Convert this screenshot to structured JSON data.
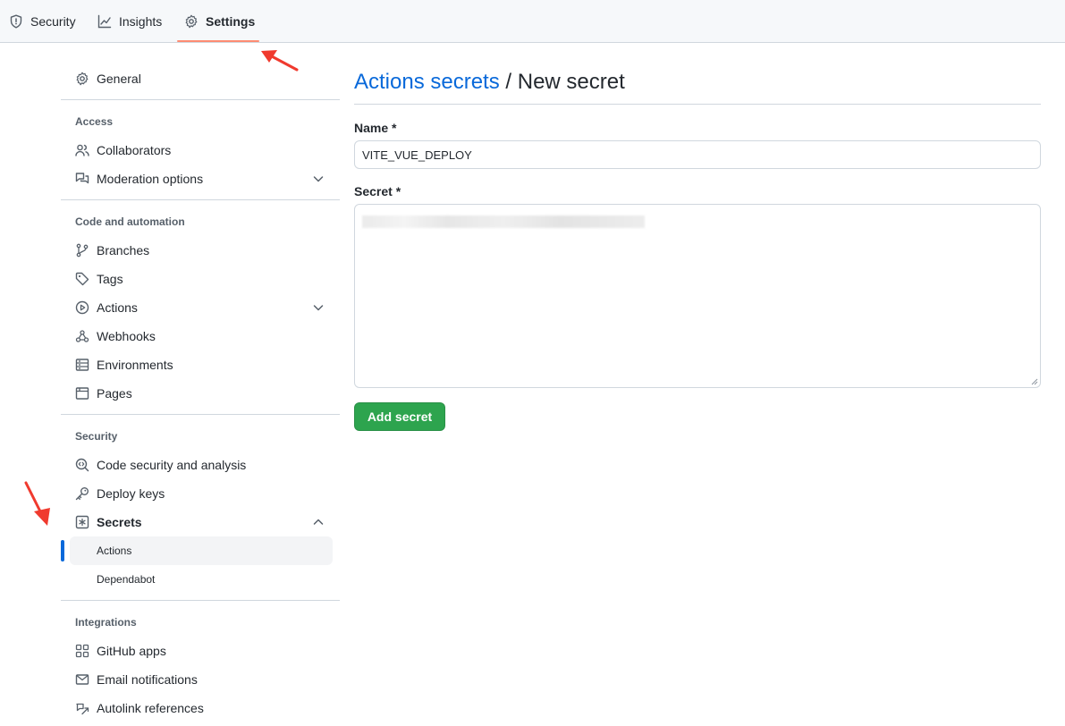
{
  "tabs": [
    {
      "label": "Security",
      "icon": "shield-icon"
    },
    {
      "label": "Insights",
      "icon": "graph-icon"
    },
    {
      "label": "Settings",
      "icon": "gear-icon",
      "selected": true
    }
  ],
  "sidebar": {
    "general": "General",
    "sections": [
      {
        "heading": "Access",
        "items": [
          "Collaborators",
          "Moderation options"
        ]
      },
      {
        "heading": "Code and automation",
        "items": [
          "Branches",
          "Tags",
          "Actions",
          "Webhooks",
          "Environments",
          "Pages"
        ]
      },
      {
        "heading": "Security",
        "items": [
          "Code security and analysis",
          "Deploy keys",
          "Secrets"
        ],
        "sub_items": [
          "Actions",
          "Dependabot"
        ]
      },
      {
        "heading": "Integrations",
        "items": [
          "GitHub apps",
          "Email notifications",
          "Autolink references"
        ]
      }
    ]
  },
  "main": {
    "breadcrumb_link": "Actions secrets",
    "breadcrumb_separator": " / ",
    "title": "New secret",
    "name_label": "Name *",
    "name_value": "VITE_VUE_DEPLOY",
    "secret_label": "Secret *",
    "submit_label": "Add secret"
  },
  "colors": {
    "accent_link": "#0969da",
    "primary_button": "#2da44e",
    "tab_underline": "#fd8c73",
    "annotation_arrow": "#f03a2e"
  }
}
